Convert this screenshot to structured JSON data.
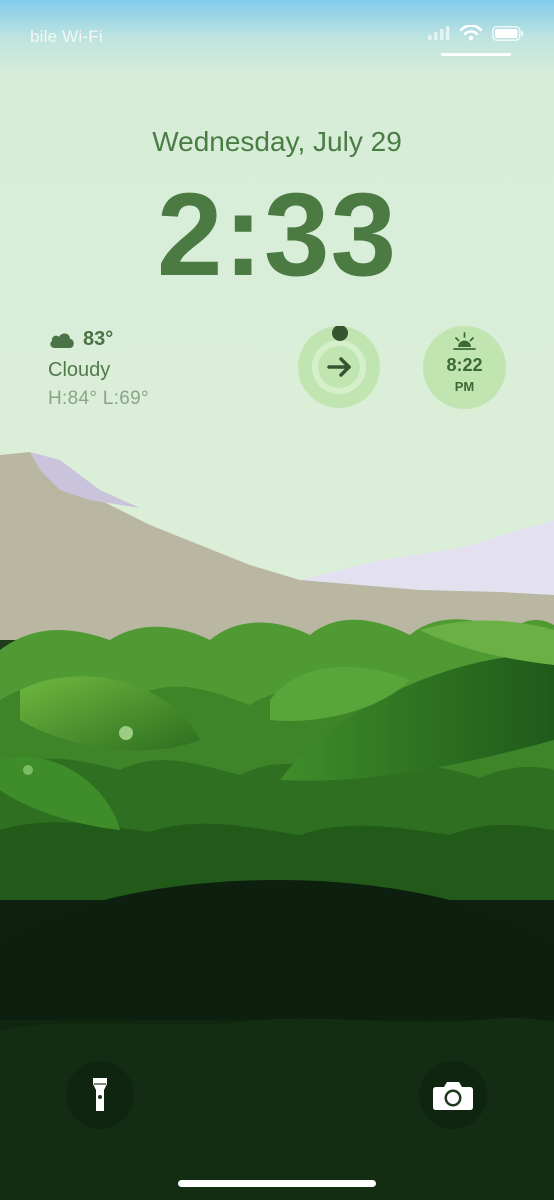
{
  "status_bar": {
    "carrier": "bile Wi-Fi",
    "icons": [
      "cellular-signal-icon",
      "wifi-icon",
      "battery-icon"
    ]
  },
  "lock_screen": {
    "date": "Wednesday, July 29",
    "time": "2:33"
  },
  "widgets": {
    "weather": {
      "icon": "cloud-icon",
      "temperature": "83°",
      "condition": "Cloudy",
      "high_low": "H:84° L:69°"
    },
    "activity_ring": {
      "icon": "arrow-right-icon"
    },
    "sunset": {
      "icon": "sunset-icon",
      "time": "8:22",
      "ampm": "PM"
    }
  },
  "bottom_actions": {
    "left_icon": "flashlight-icon",
    "right_icon": "camera-icon"
  },
  "colors": {
    "text_green": "#4b7a42",
    "sky_top": "#7cc8ec",
    "sky_bottom": "#dceedd",
    "mountain": "#b8b8a0",
    "foliage_dark": "#0d1f0f"
  }
}
